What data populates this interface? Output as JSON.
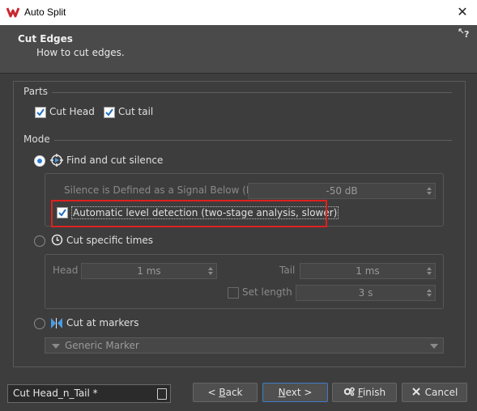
{
  "window": {
    "title": "Auto Split",
    "close_glyph": "✕"
  },
  "header": {
    "title": "Cut Edges",
    "subtitle": "How to cut edges.",
    "help_glyph": "?"
  },
  "parts": {
    "label": "Parts",
    "cut_head": {
      "label": "Cut Head",
      "checked": true
    },
    "cut_tail": {
      "label": "Cut tail",
      "checked": true
    }
  },
  "mode": {
    "label": "Mode",
    "find_cut_silence": {
      "label": "Find and cut silence",
      "selected": true
    },
    "silence_threshold": {
      "label": "Silence is Defined as a Signal Below (RMS)",
      "value": "-50 dB"
    },
    "auto_level": {
      "label": "Automatic level detection (two-stage analysis, slower)",
      "checked": true
    },
    "cut_specific_times": {
      "label": "Cut specific times",
      "selected": false
    },
    "head": {
      "label": "Head",
      "value": "1 ms"
    },
    "tail": {
      "label": "Tail",
      "value": "1 ms"
    },
    "set_length": {
      "label": "Set length",
      "checked": false,
      "value": "3 s"
    },
    "cut_at_markers": {
      "label": "Cut at markers",
      "selected": false
    },
    "marker_type": {
      "value": "Generic Marker"
    }
  },
  "footer": {
    "preset": "Cut Head_n_Tail *",
    "back": {
      "prefix": "< ",
      "mnemonic": "B",
      "rest": "ack"
    },
    "next": {
      "mnemonic": "N",
      "rest": "ext >"
    },
    "finish": {
      "mnemonic": "F",
      "rest": "inish"
    },
    "cancel": "Cancel"
  },
  "colors": {
    "accent": "#2f7fd8",
    "highlight": "#e02020",
    "background": "#3d3d3d"
  }
}
